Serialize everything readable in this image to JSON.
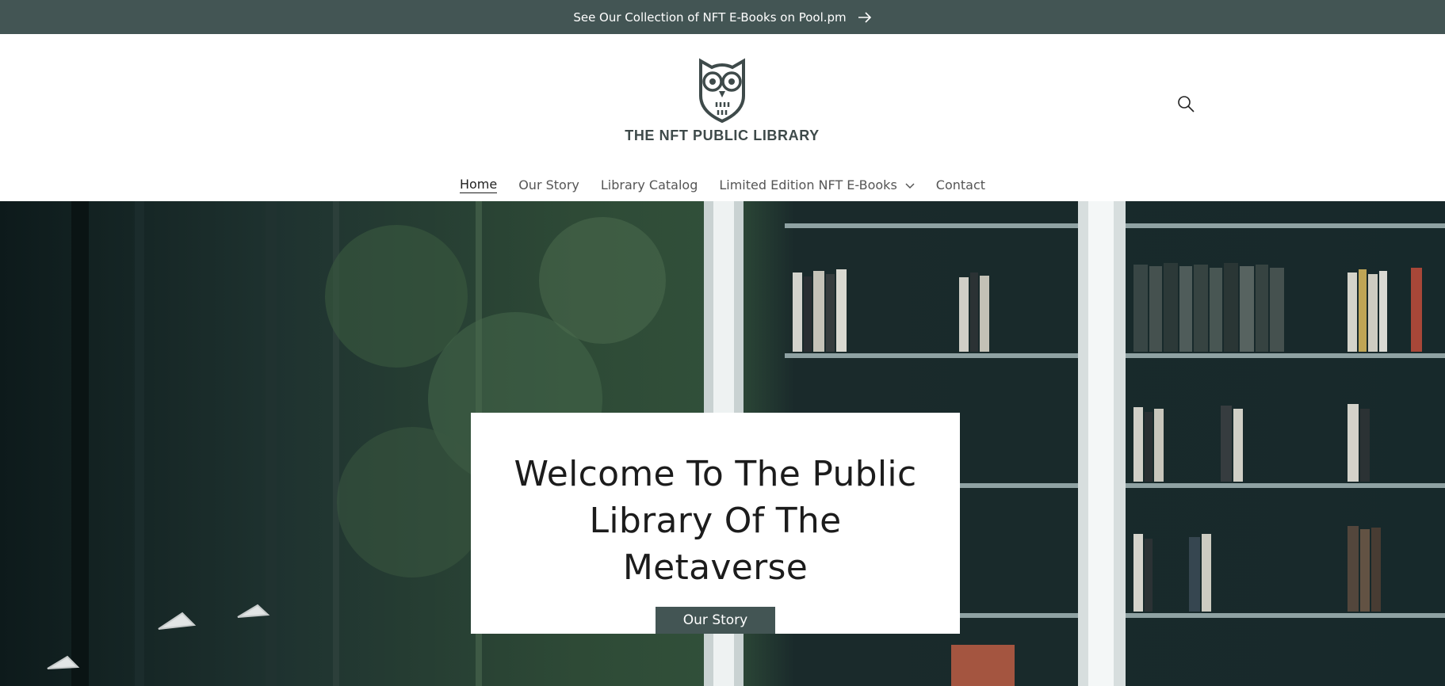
{
  "announcement": {
    "text": "See Our Collection of NFT E-Books on Pool.pm",
    "icon": "arrow-right-icon"
  },
  "brand": {
    "name": "THE NFT PUBLIC LIBRARY",
    "logo_icon": "owl-logo-icon",
    "color": "#435554"
  },
  "header": {
    "search_icon": "search-icon"
  },
  "nav": {
    "items": [
      {
        "label": "Home",
        "active": true
      },
      {
        "label": "Our Story"
      },
      {
        "label": "Library Catalog"
      },
      {
        "label": "Limited Edition NFT E-Books",
        "has_dropdown": true
      },
      {
        "label": "Contact"
      }
    ]
  },
  "hero": {
    "title": "Welcome To The Public Library Of The Metaverse",
    "button_label": "Our Story"
  },
  "colors": {
    "accent": "#435554",
    "text": "#1f1f1f",
    "background": "#ffffff"
  }
}
